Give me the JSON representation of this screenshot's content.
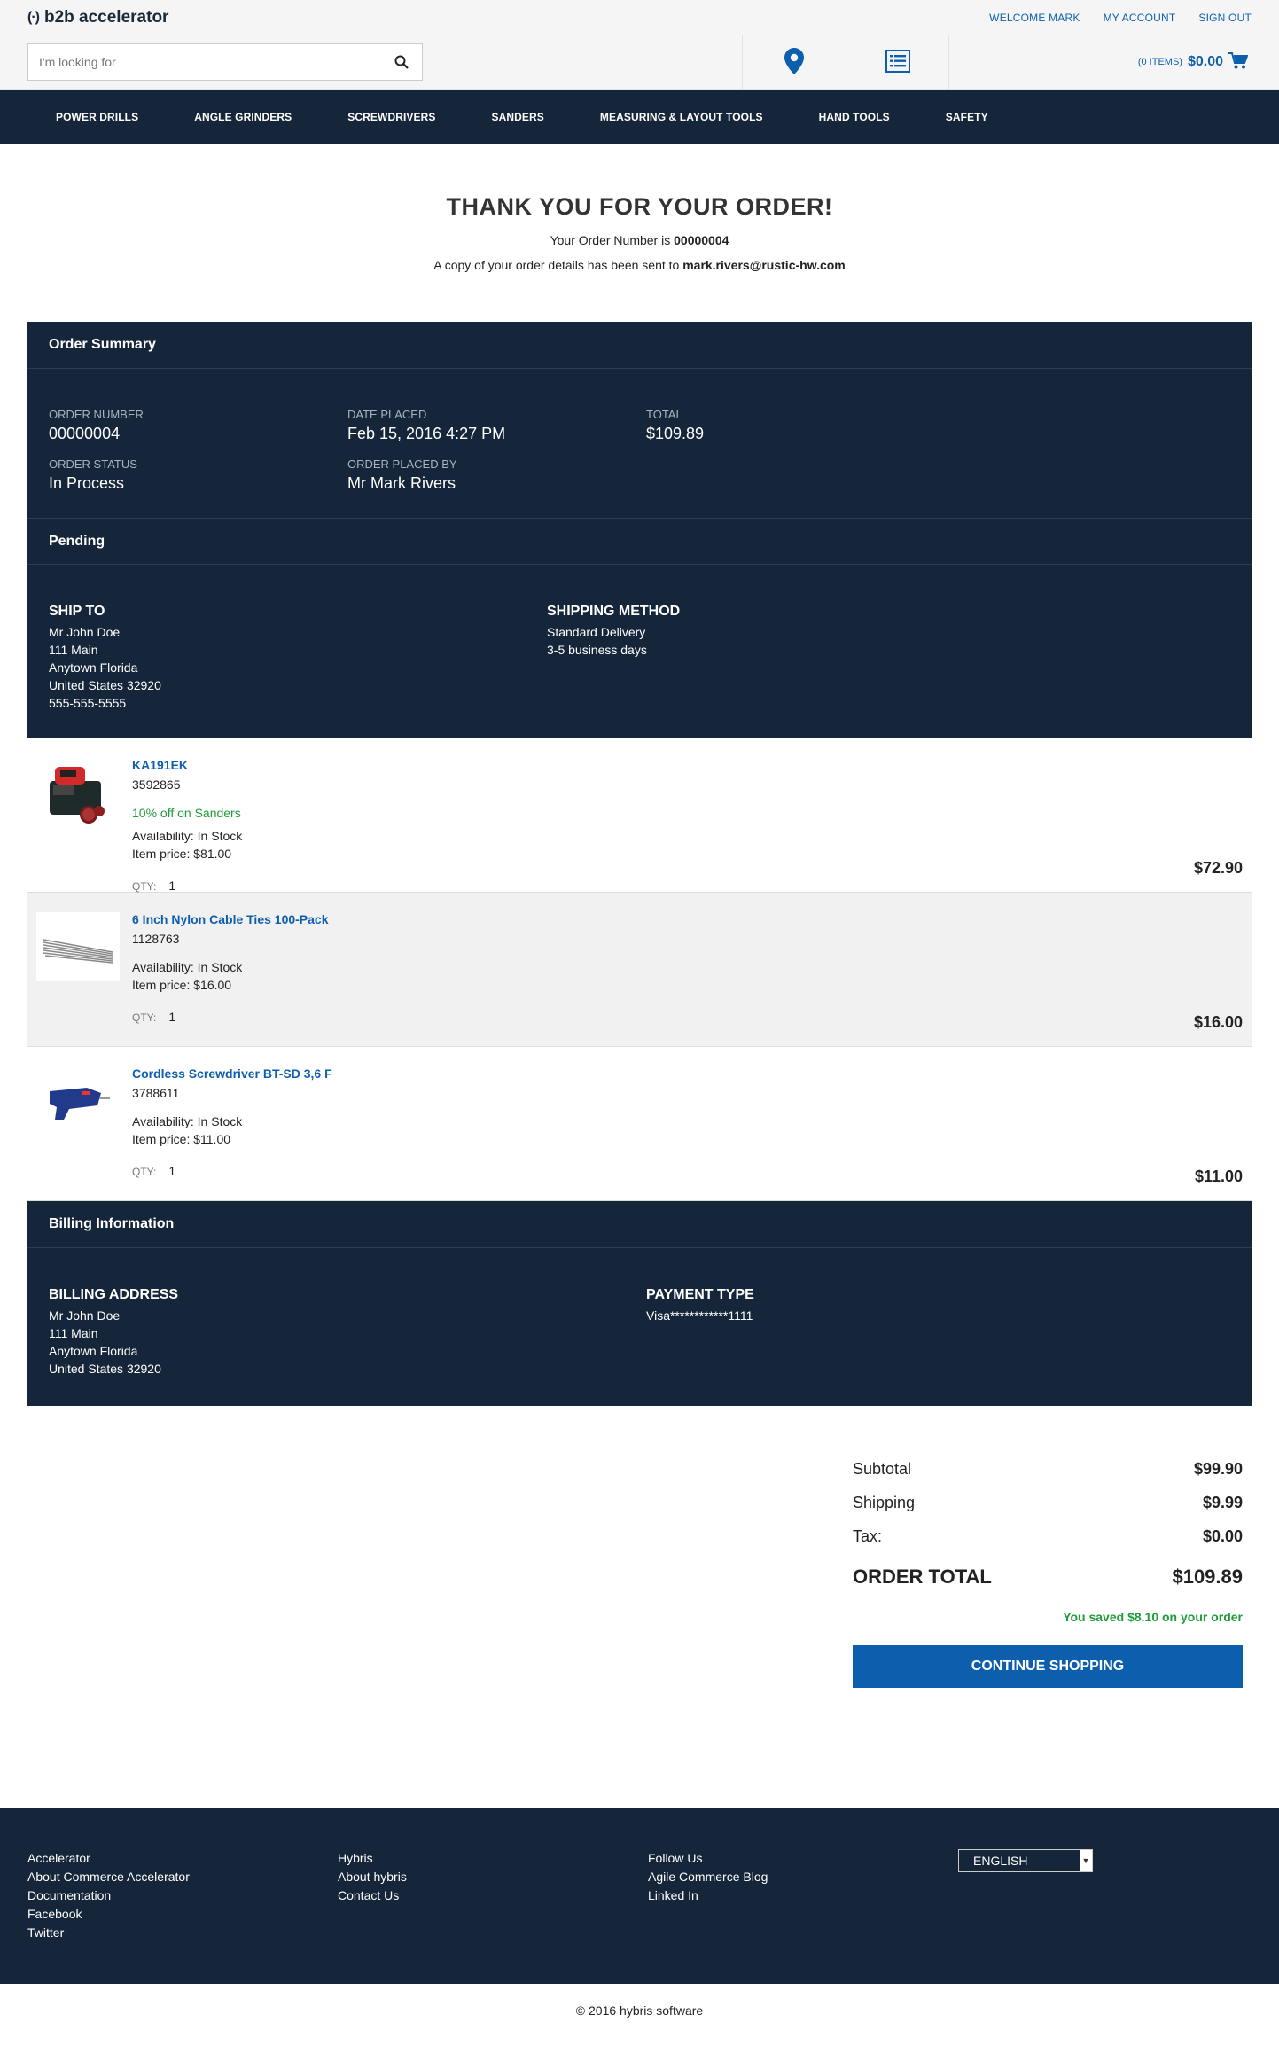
{
  "header": {
    "logo_mark": "(·)",
    "logo_text": "b2b accelerator",
    "links": [
      "WELCOME MARK",
      "MY ACCOUNT",
      "SIGN OUT"
    ],
    "search_placeholder": "I'm looking for",
    "cart_items": "(0 ITEMS)",
    "cart_total": "$0.00"
  },
  "nav": [
    "POWER DRILLS",
    "ANGLE GRINDERS",
    "SCREWDRIVERS",
    "SANDERS",
    "MEASURING & LAYOUT TOOLS",
    "HAND TOOLS",
    "SAFETY"
  ],
  "confirmation": {
    "title": "THANK YOU FOR YOUR ORDER!",
    "order_prefix": "Your Order Number is ",
    "order_number": "00000004",
    "email_prefix": "A copy of your order details has been sent to ",
    "email": "mark.rivers@rustic-hw.com"
  },
  "summary": {
    "title": "Order Summary",
    "order_number_label": "ORDER NUMBER",
    "order_number": "00000004",
    "date_label": "DATE PLACED",
    "date": "Feb 15, 2016 4:27 PM",
    "total_label": "TOTAL",
    "total": "$109.89",
    "status_label": "ORDER STATUS",
    "status": "In Process",
    "placed_by_label": "ORDER PLACED BY",
    "placed_by": "Mr Mark Rivers"
  },
  "pending": {
    "title": "Pending",
    "ship_to_title": "SHIP TO",
    "ship_to": [
      "Mr  John Doe",
      "111 Main",
      "Anytown Florida",
      "United States 32920",
      "555-555-5555"
    ],
    "method_title": "SHIPPING METHOD",
    "method": [
      "Standard Delivery",
      "3-5 business days"
    ]
  },
  "items": [
    {
      "name": "KA191EK",
      "sku": "3592865",
      "promo": "10% off on Sanders",
      "availability": "Availability: In Stock",
      "price": "Item price: $81.00",
      "qty_label": "QTY:",
      "qty": "1",
      "total": "$72.90"
    },
    {
      "name": "6 Inch Nylon Cable Ties 100-Pack",
      "sku": "1128763",
      "availability": "Availability: In Stock",
      "price": "Item price: $16.00",
      "qty_label": "QTY:",
      "qty": "1",
      "total": "$16.00"
    },
    {
      "name": "Cordless Screwdriver BT-SD 3,6 F",
      "sku": "3788611",
      "availability": "Availability: In Stock",
      "price": "Item price: $11.00",
      "qty_label": "QTY:",
      "qty": "1",
      "total": "$11.00"
    }
  ],
  "billing": {
    "title": "Billing Information",
    "address_title": "BILLING ADDRESS",
    "address": [
      "Mr  John Doe",
      "111 Main",
      "Anytown Florida",
      "United States 32920"
    ],
    "payment_title": "PAYMENT TYPE",
    "payment": "Visa************1111"
  },
  "totals": {
    "subtotal_label": "Subtotal",
    "subtotal": "$99.90",
    "shipping_label": "Shipping",
    "shipping": "$9.99",
    "tax_label": "Tax:",
    "tax": "$0.00",
    "order_total_label": "ORDER TOTAL",
    "order_total": "$109.89",
    "saved": "You saved $8.10 on your order",
    "continue_label": "CONTINUE SHOPPING"
  },
  "footer": {
    "col1": [
      "Accelerator",
      "About Commerce Accelerator",
      "Documentation",
      "Facebook",
      "Twitter"
    ],
    "col2": [
      "Hybris",
      "About hybris",
      "Contact Us"
    ],
    "col3": [
      "Follow Us",
      "Agile Commerce Blog",
      "Linked In"
    ],
    "language": "ENGLISH",
    "copyright": "© 2016 hybris software"
  },
  "colors": {
    "brand_blue": "#0d5fae",
    "dark_navy": "#15263a",
    "promo_green": "#1f9c3a"
  }
}
